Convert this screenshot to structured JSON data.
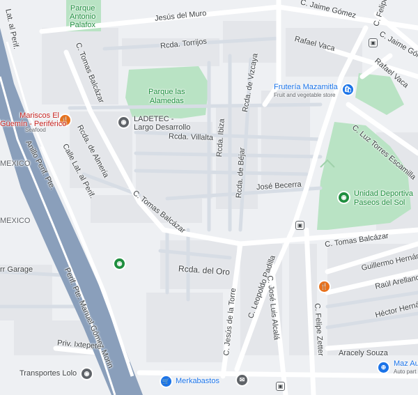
{
  "map": {
    "colors": {
      "background": "#eef0f3",
      "block": "#e4e6ea",
      "road": "#ffffff",
      "street_minor": "#d7dde5",
      "highway": "#8a9fbb",
      "park": "#b9e3c4",
      "park_dark": "#a6dbb3",
      "poi_green": "#1e8e3e",
      "poi_food": "#e8711c",
      "poi_shop": "#1a73e8"
    },
    "streets": {
      "jesus_del_muro": "Jesús del Muro",
      "c_jaime_gomez_top": "C. Jaime Gómez",
      "c_felipe_top": "C. Felipe",
      "c_jaime_gomez_right": "C. Jaime Góme",
      "rafael_vaca_1": "Rafael Vaca",
      "rafael_vaca_2": "Rafael Vaca",
      "rcda_torrijos": "Rcda. Torrijos",
      "lat_al_perif_top": "Lat. al Perif.",
      "c_tomas_balcazar_1": "C. Tomas Balcázar",
      "c_tomas_balcazar_2": "C. Tomas Balcázar",
      "c_tomas_balcazar_3": "C. Tomas Balcázar",
      "rcda_de_vizcaya": "Rcda. de Vizcaya",
      "rcda_de_almeria": "Rcda. de Almeria",
      "calle_lat_al_perif": "Calle Lat. al Perif.",
      "rcda_villalta": "Rcda. Villalta",
      "rcda_ibiza": "Rcda. Ibiza",
      "rcda_de_bejar": "Rcda. de Béjar",
      "c_luz_torres_escamilla": "C. Luz Torres Escamilla",
      "jose_becerra": "José Becerra",
      "anillo_perif_pte": "Anillo Perif. Pte.",
      "perif_pte_manuel_gomez_morin": "Perif. Pte. Manuel Gómez Morin",
      "rcda_del_oro": "Rcda. del Oro",
      "c_jesus_de_la_torre": "C. Jesús de la Torre",
      "c_leopoldo_padilla": "C. Leopoldo Padilla",
      "c_jose_luis_alcala": "C. José Luis Alcalá",
      "c_felipe_zetter": "C. Felipe Zetter",
      "guillermo_hernandez": "Guillermo Hernánde",
      "raul_arellano": "Raúl Arellano",
      "hector_hernandez": "Héctor Herná",
      "aracely_souza": "Aracely Souza",
      "priv_ixtepete": "Priv. Ixtepete",
      "mexico_1": "MEXICO",
      "mexico_2": "MEXICO"
    },
    "places": {
      "parque_antonio_palafox": "Parque\nAntonio\nPalafox",
      "parque_las_alamedas": "Parque las\nAlamedas",
      "ladetec": "LADETEC -\nLargo Desarrollo",
      "mariscos": "Mariscos El\nGüemín - Periférico",
      "mariscos_sub": "Seafood",
      "fruteria": "Frutería Mazamitla",
      "fruteria_sub": "Fruit and vegetable store",
      "unidad_deportiva": "Unidad Deportiva\nPaseos del Sol",
      "garage": "rr Garage",
      "transportes_lolo": "Transportes Lolo",
      "merkabastos": "Merkabastos",
      "maz_auto": "Maz Au",
      "maz_auto_sub": "Auto part"
    }
  }
}
